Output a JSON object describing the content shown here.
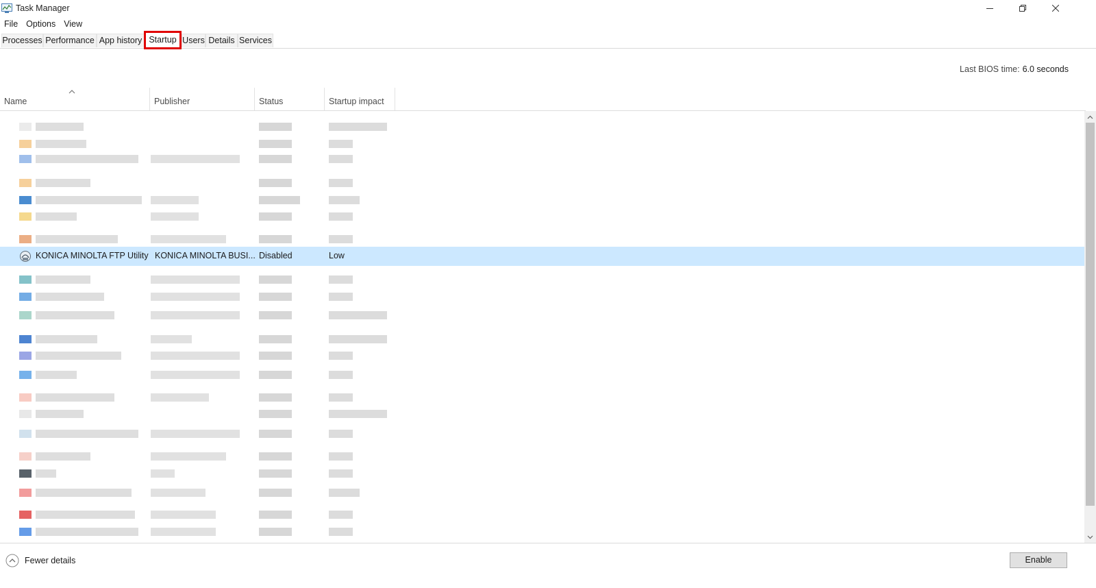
{
  "window": {
    "title": "Task Manager"
  },
  "menu": [
    "File",
    "Options",
    "View"
  ],
  "tabs": [
    "Processes",
    "Performance",
    "App history",
    "Startup",
    "Users",
    "Details",
    "Services"
  ],
  "active_tab": "Startup",
  "bios": {
    "label": "Last BIOS time:",
    "value": "6.0 seconds"
  },
  "columns": {
    "name": "Name",
    "publisher": "Publisher",
    "status": "Status",
    "impact": "Startup impact"
  },
  "selected_row": {
    "name": "KONICA MINOLTA FTP Utility",
    "publisher": "KONICA MINOLTA BUSI...",
    "status": "Disabled",
    "impact": "Low"
  },
  "footer": {
    "fewer_details": "Fewer details",
    "enable": "Enable"
  },
  "colors": {
    "selection": "#cce8ff",
    "highlight": "#e00000"
  }
}
